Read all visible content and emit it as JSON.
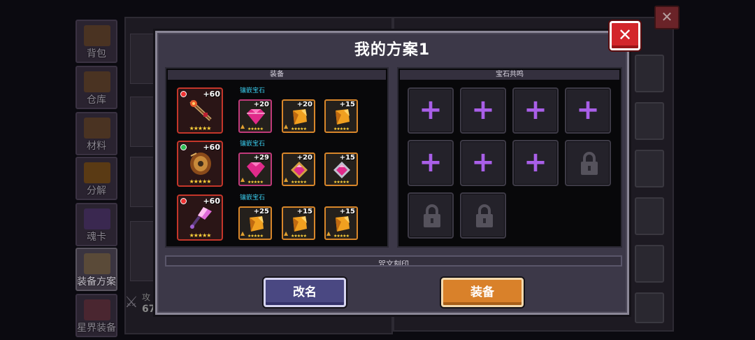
{
  "background": {
    "sidebar": [
      {
        "label": "背包",
        "icon": "backpack-icon"
      },
      {
        "label": "仓库",
        "icon": "chest-icon"
      },
      {
        "label": "材料",
        "icon": "materials-icon"
      },
      {
        "label": "分解",
        "icon": "decompose-icon"
      },
      {
        "label": "魂卡",
        "icon": "soul-card-icon"
      },
      {
        "label": "装备方案",
        "icon": "equip-plan-icon"
      },
      {
        "label": "星界装备",
        "icon": "astral-gear-icon"
      }
    ],
    "attack_label_partial": "攻",
    "attack_value_partial": "67"
  },
  "modal": {
    "title": "我的方案1",
    "close_icon": "close-icon",
    "equipment_header": "装备",
    "resonance_header": "宝石共鸣",
    "rune_header": "咒文刻印",
    "rename_label": "改名",
    "equip_label": "装备"
  },
  "equipment": [
    {
      "plus": "+60",
      "stars": "★★★★★",
      "tag": "red",
      "icon": "fire-staff-icon",
      "gem_label": "镶嵌宝石",
      "gems": [
        {
          "plus": "+20",
          "icon": "pink-gem-icon"
        },
        {
          "plus": "+20",
          "icon": "orange-scroll-icon"
        },
        {
          "plus": "+15",
          "icon": "orange-scroll-icon"
        }
      ]
    },
    {
      "plus": "+60",
      "stars": "★★★★★",
      "tag": "green",
      "icon": "bronze-shield-icon",
      "gem_label": "镶嵌宝石",
      "gems": [
        {
          "plus": "+29",
          "icon": "pink-gem-icon"
        },
        {
          "plus": "+20",
          "icon": "pink-gem-gold-icon"
        },
        {
          "plus": "+15",
          "icon": "pink-gem-silver-icon"
        }
      ]
    },
    {
      "plus": "+60",
      "stars": "★★★★★",
      "tag": "red",
      "icon": "crystal-wand-icon",
      "gem_label": "镶嵌宝石",
      "gems": [
        {
          "plus": "+25",
          "icon": "orange-scroll-icon"
        },
        {
          "plus": "+15",
          "icon": "orange-scroll-icon"
        },
        {
          "plus": "+15",
          "icon": "orange-scroll-icon"
        }
      ]
    }
  ],
  "gem_stars": "★★★★★",
  "resonance_slots": [
    "add",
    "add",
    "add",
    "add",
    "add",
    "add",
    "add",
    "locked",
    "locked",
    "locked"
  ],
  "colors": {
    "accent_purple": "#a95fe8",
    "close_red": "#d3262b",
    "equip_orange": "#d9812a",
    "rename_blue": "#4a4882",
    "gem_label_cyan": "#38c6e6"
  }
}
